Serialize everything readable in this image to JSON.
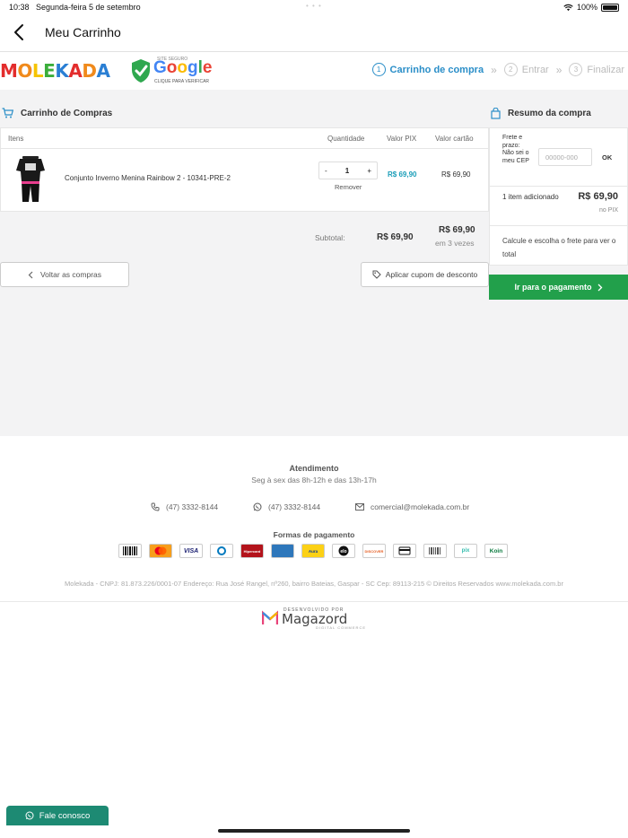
{
  "status": {
    "time": "10:38",
    "date": "Segunda-feira 5 de setembro",
    "battery": "100%"
  },
  "nav": {
    "title": "Meu Carrinho"
  },
  "header": {
    "logo": [
      "M",
      "O",
      "L",
      "E",
      "K",
      "A",
      "D",
      "A"
    ],
    "logo_colors": [
      "#e32d2d",
      "#f08a1c",
      "#f5c400",
      "#3bae3b",
      "#2a7fd4",
      "#e32d2d",
      "#f08a1c",
      "#2a7fd4"
    ],
    "seal": {
      "top": "SITE SEGURO",
      "brand": "Google",
      "bottom": "CLIQUE PARA VERIFICAR"
    },
    "steps": [
      {
        "num": "1",
        "label": "Carrinho de compra"
      },
      {
        "num": "2",
        "label": "Entrar"
      },
      {
        "num": "3",
        "label": "Finalizar"
      }
    ],
    "step_sep": "»"
  },
  "cart": {
    "title": "Carrinho de Compras",
    "columns": {
      "items": "Itens",
      "quantity": "Quantidade",
      "pix": "Valor PIX",
      "card": "Valor cartão"
    },
    "item": {
      "name": "Conjunto Inverno Menina Rainbow 2 - 10341-PRE-2",
      "qty_minus": "-",
      "qty": "1",
      "qty_plus": "+",
      "remove": "Remover",
      "pix": "R$ 69,90",
      "card": "R$ 69,90"
    },
    "subtotal_label": "Subtotal:",
    "subtotal_pix": "R$ 69,90",
    "subtotal_card": "R$ 69,90",
    "installments": "em 3 vezes",
    "back_button": "Voltar as compras",
    "coupon_button": "Aplicar cupom de desconto"
  },
  "summary": {
    "title": "Resumo da compra",
    "frete": "Frete e prazo:",
    "nao_sei": "Não sei o meu CEP",
    "cep_placeholder": "00000-000",
    "ok": "OK",
    "items_added": "1 item adicionado",
    "total": "R$ 69,90",
    "total_note": "no PIX",
    "calc": "Calcule e escolha o frete para ver o total",
    "pay_button": "Ir para o pagamento"
  },
  "footer": {
    "att_title": "Atendimento",
    "att_hours": "Seg à sex das 8h-12h e das 13h-17h",
    "phone": "(47) 3332-8144",
    "whatsapp": "(47) 3332-8144",
    "email": "comercial@molekada.com.br",
    "payments_title": "Formas de pagamento",
    "payments": [
      "boleto",
      "MasterCard",
      "VISA",
      "Diners",
      "Hipercard",
      "Amex",
      "Aura",
      "elo",
      "DISCOVER",
      "cartão",
      "boleto",
      "pix",
      "Koin"
    ],
    "legal": "Molekada - CNPJ: 81.873.226/0001-07 Endereço: Rua José Rangel, nº260, bairro Bateias, Gaspar - SC Cep: 89113-215 © Direitos Reservados www.molekada.com.br",
    "dev_small": "DESENVOLVIDO POR",
    "dev_brand": "Magazord",
    "dev_sub": "DIGITAL COMMERCE"
  },
  "chat": {
    "label": "Fale conosco"
  },
  "colors": {
    "accent": "#2a8ec8",
    "pix": "#1a9db8",
    "pay_button": "#22a04b",
    "chat": "#1d8a73"
  }
}
